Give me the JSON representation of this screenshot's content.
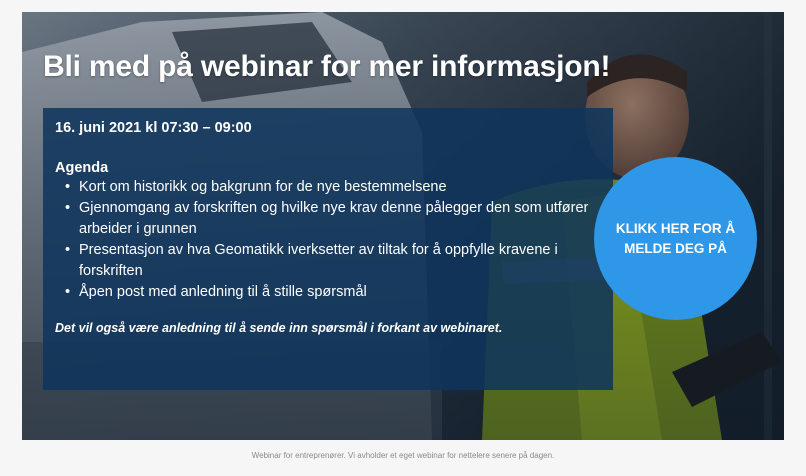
{
  "banner": {
    "headline": "Bli med på webinar for mer informasjon!",
    "date": "16. juni 2021 kl 07:30 – 09:00",
    "agenda_title": "Agenda",
    "agenda_items": [
      {
        "bullet": "•",
        "text": "Kort om historikk og bakgrunn for de nye bestemmelsene"
      },
      {
        "bullet": "•",
        "text": "Gjennomgang av forskriften og hvilke nye krav denne pålegger den som utfører arbeider i grunnen"
      },
      {
        "bullet": "•",
        "text": "Presentasjon av hva Geomatikk iverksetter av tiltak for å oppfylle kravene i forskriften"
      },
      {
        "bullet": "•",
        "text": "Åpen post med anledning til å stille spørsmål"
      }
    ],
    "note": "Det vil også være anledning til å sende inn spørsmål i forkant av webinaret.",
    "cta_label": "KLIKK HER FOR Å MELDE DEG PÅ"
  },
  "caption": "Webinar for entreprenører. Vi avholder et eget webinar for nettelere senere på dagen.",
  "colors": {
    "info_box": "#0e345c",
    "cta": "#2e97e8",
    "vest": "#c7e820"
  }
}
